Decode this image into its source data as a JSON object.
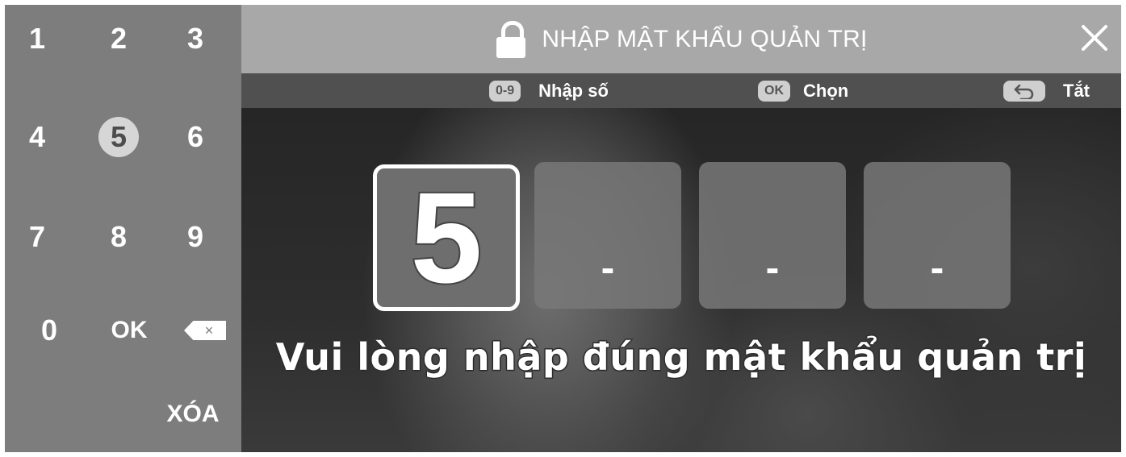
{
  "keypad": {
    "keys": [
      {
        "label": "1"
      },
      {
        "label": "2"
      },
      {
        "label": "3"
      },
      {
        "label": "4"
      },
      {
        "label": "5"
      },
      {
        "label": "6"
      },
      {
        "label": "7"
      },
      {
        "label": "8"
      },
      {
        "label": "9"
      },
      {
        "label": "0"
      },
      {
        "label": "OK"
      }
    ],
    "backspace_symbol": "×",
    "clear_label": "XÓA",
    "selected_key": "5",
    "icons": {
      "backspace": "backspace-icon"
    }
  },
  "dialog": {
    "title": "NHẬP MẬT KHẨU QUẢN TRỊ",
    "icons": {
      "title": "lock-icon",
      "close": "close-icon",
      "back": "back-arrow-icon"
    },
    "hints": {
      "digits_badge": "0-9",
      "digits_label": "Nhập số",
      "ok_badge": "OK",
      "ok_label": "Chọn",
      "back_label": "Tắt"
    },
    "pin": [
      {
        "value": "5",
        "active": true
      },
      {
        "value": "-",
        "active": false
      },
      {
        "value": "-",
        "active": false
      },
      {
        "value": "-",
        "active": false
      }
    ],
    "message": "Vui lòng nhập đúng mật khẩu quản trị"
  },
  "colors": {
    "keypad_bg": "#7d7d7d",
    "titlebar_bg": "#a8a8a8",
    "hintbar_bg": "#505050",
    "text": "#ffffff"
  }
}
